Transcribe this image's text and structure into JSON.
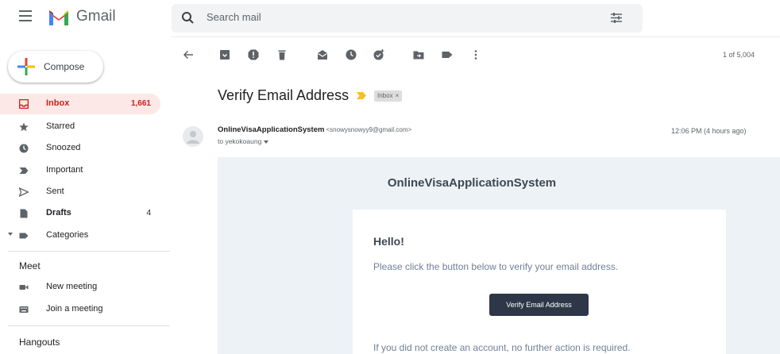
{
  "app": {
    "name": "Gmail"
  },
  "search": {
    "placeholder": "Search mail"
  },
  "compose": {
    "label": "Compose"
  },
  "sidebar": {
    "items": [
      {
        "label": "Inbox",
        "count": "1,661"
      },
      {
        "label": "Starred",
        "count": ""
      },
      {
        "label": "Snoozed",
        "count": ""
      },
      {
        "label": "Important",
        "count": ""
      },
      {
        "label": "Sent",
        "count": ""
      },
      {
        "label": "Drafts",
        "count": "4"
      },
      {
        "label": "Categories",
        "count": ""
      }
    ]
  },
  "meet": {
    "title": "Meet",
    "new_meeting": "New meeting",
    "join_meeting": "Join a meeting"
  },
  "hangouts": {
    "title": "Hangouts"
  },
  "toolbar": {
    "pager": "1 of 5,004"
  },
  "message": {
    "subject": "Verify Email Address",
    "label": "Inbox",
    "label_close": "×",
    "sender_name": "OnlineVisaApplicationSystem",
    "sender_email": "<snowysnowyy9@gmail.com>",
    "to": "to yekokoaung",
    "time": "12:06 PM (4 hours ago)"
  },
  "email": {
    "app_name": "OnlineVisaApplicationSystem",
    "greeting": "Hello!",
    "instruction": "Please click the button below to verify your email address.",
    "button": "Verify Email Address",
    "footer": "If you did not create an account, no further action is required."
  },
  "colors": {
    "accent_red": "#c5221f",
    "inbox_highlight": "#fce8e6",
    "email_bg": "#edf2f7",
    "button_bg": "#2d3748",
    "important_marker": "#f6bf26"
  },
  "icons": [
    "menu-icon",
    "gmail-logo",
    "search-icon",
    "tune-icon",
    "plus-icon",
    "inbox-icon",
    "star-icon",
    "clock-icon",
    "important-icon",
    "send-icon",
    "draft-icon",
    "label-icon",
    "video-icon",
    "keyboard-icon",
    "back-arrow-icon",
    "archive-icon",
    "report-spam-icon",
    "delete-icon",
    "mark-unread-icon",
    "snooze-icon",
    "add-task-icon",
    "move-to-icon",
    "labels-icon",
    "more-icon",
    "avatar-icon"
  ]
}
